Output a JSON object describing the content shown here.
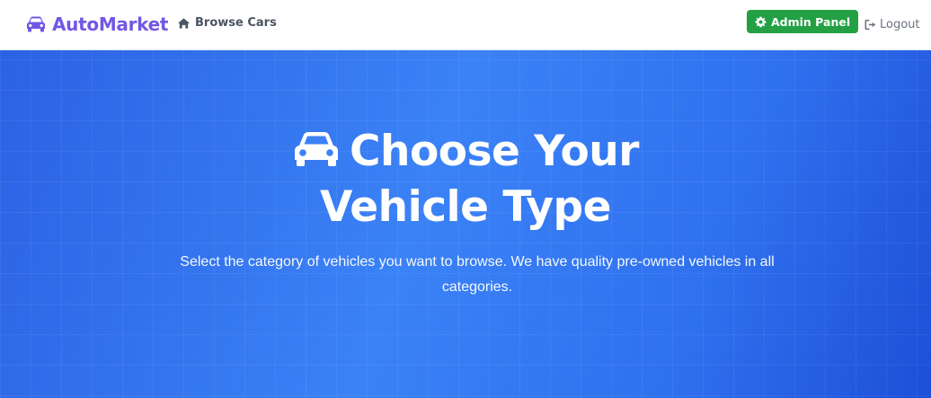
{
  "navbar": {
    "brand": "AutoMarket",
    "browse_label": "Browse Cars",
    "admin_label": "Admin Panel",
    "logout_label": "Logout"
  },
  "hero": {
    "title": "Choose Your Vehicle Type",
    "subtitle": "Select the category of vehicles you want to browse. We have quality pre-owned vehicles in all categories."
  },
  "icons": {
    "brand": "car-icon",
    "browse": "home-icon",
    "admin": "gear-icon",
    "logout": "logout-icon",
    "title": "car-icon"
  },
  "colors": {
    "brand": "#7257e4",
    "admin_button": "#23a044",
    "hero_background": "#3b82f6"
  }
}
